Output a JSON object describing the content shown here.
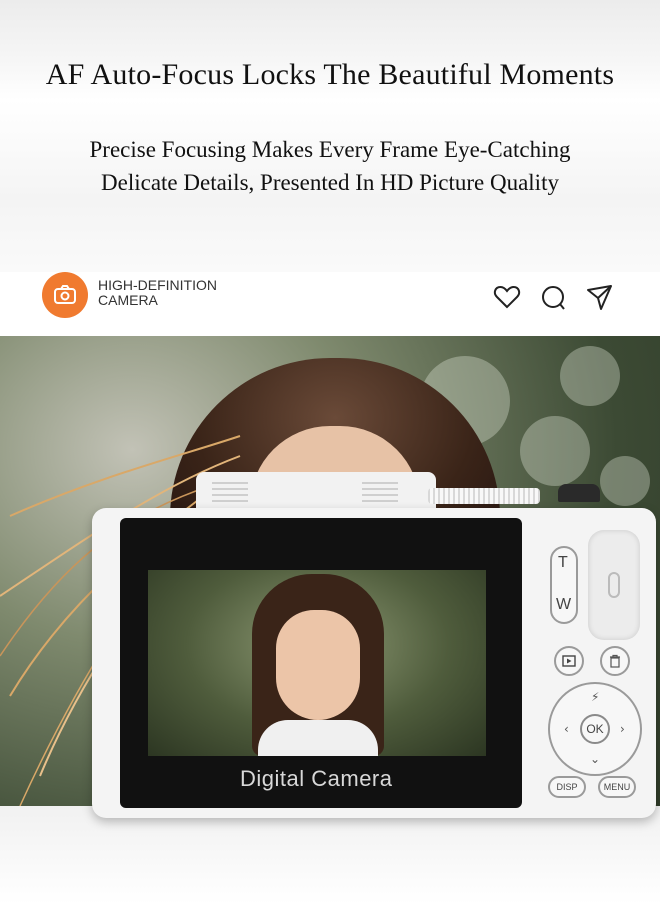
{
  "banner": {
    "headline": "AF Auto-Focus Locks The Beautiful Moments",
    "subline1": "Precise Focusing Makes Every Frame Eye-Catching",
    "subline2": "Delicate Details, Presented In HD Picture Quality"
  },
  "post": {
    "brand_line1": "HIGH-DEFINITION",
    "brand_line2": "CAMERA",
    "avatar_color": "#f07a2f",
    "actions": [
      "heart-icon",
      "comment-icon",
      "share-icon"
    ]
  },
  "camera": {
    "screen_label": "Digital  Camera",
    "zoom_tele": "T",
    "zoom_wide": "W",
    "ok_label": "OK",
    "disp_label": "DISP",
    "menu_label": "MENU"
  }
}
